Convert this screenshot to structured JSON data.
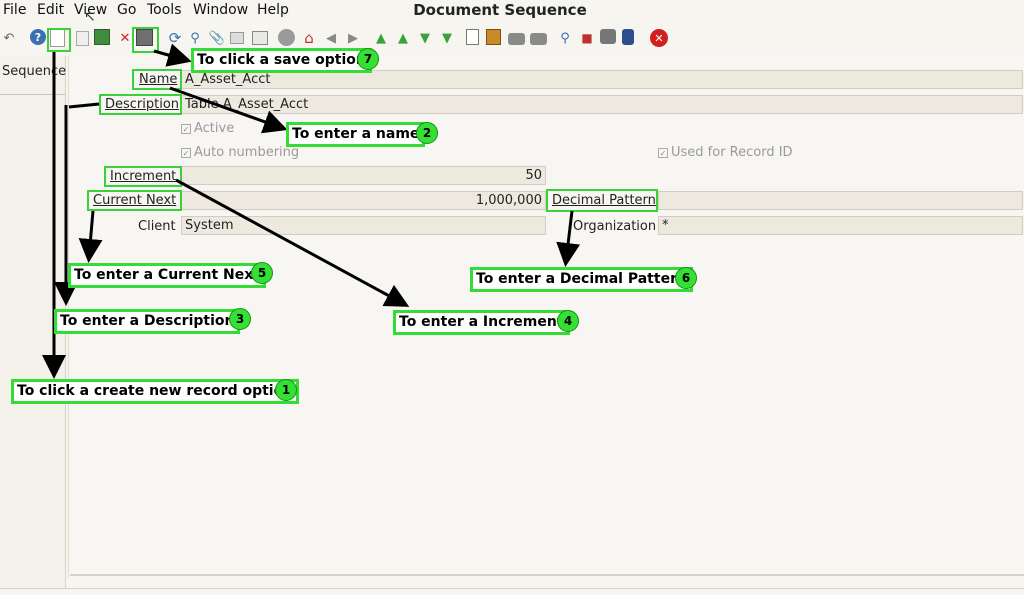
{
  "menu": {
    "file": "File",
    "edit": "Edit",
    "view": "View",
    "go": "Go",
    "tools": "Tools",
    "window": "Window",
    "help": "Help"
  },
  "window_title": "Document Sequence",
  "side_panel": {
    "label": "Sequence"
  },
  "form": {
    "name_label": "Name",
    "name_value": "A_Asset_Acct",
    "description_label": "Description",
    "description_value": "Table A_Asset_Acct",
    "active_label": "Active",
    "active_checked": true,
    "auto_numbering_label": "Auto numbering",
    "auto_numbering_checked": true,
    "used_for_record_id_label": "Used for Record ID",
    "used_for_record_id_checked": true,
    "increment_label": "Increment",
    "increment_value": "50",
    "current_next_label": "Current Next",
    "current_next_value": "1,000,000",
    "decimal_pattern_label": "Decimal Pattern",
    "decimal_pattern_value": "",
    "client_label": "Client",
    "client_value": "System",
    "organization_label": "Organization",
    "organization_value": "*"
  },
  "annotations": {
    "c1": "To click a create new record option",
    "b1": "1",
    "c2": "To enter a name",
    "b2": "2",
    "c3": "To enter a Description",
    "b3": "3",
    "c4": "To enter a Increment",
    "b4": "4",
    "c5": "To enter a Current Next",
    "b5": "5",
    "c6": "To enter a Decimal Pattern",
    "b6": "6",
    "c7": "To click a save option",
    "b7": "7"
  },
  "colors": {
    "annotation_green": "#33dd33",
    "background": "#f7f5f0",
    "field_bg": "#ede9df"
  },
  "toolbar_icons": [
    "undo-icon",
    "help-icon",
    "new-record-icon",
    "copy-record-icon",
    "delete-icon",
    "delete-selection-icon",
    "save-icon",
    "refresh-icon",
    "find-icon",
    "attachment-icon",
    "chat-icon",
    "grid-toggle-icon",
    "history-icon",
    "home-icon",
    "back-icon",
    "forward-icon",
    "first-record-icon",
    "previous-record-icon",
    "next-record-icon",
    "last-record-icon",
    "report-icon",
    "archive-icon",
    "print-preview-icon",
    "print-icon",
    "zoom-across-icon",
    "workflow-icon",
    "requests-icon",
    "product-info-icon",
    "close-window-icon"
  ]
}
